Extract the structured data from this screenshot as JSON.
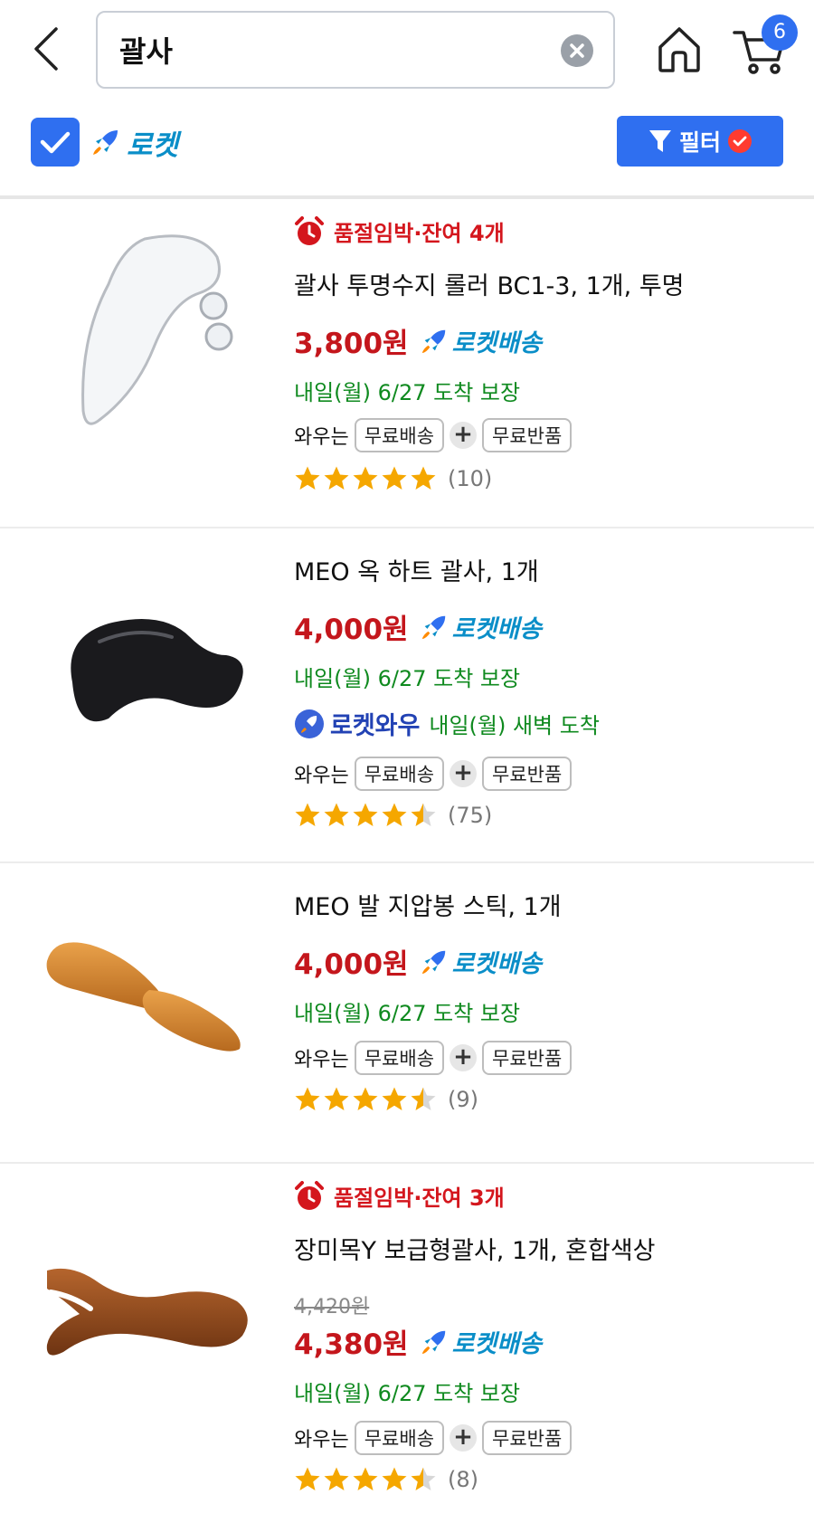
{
  "header": {
    "search": {
      "value": "괄사",
      "placeholder": ""
    },
    "cart_count": "6",
    "rocket_filter": {
      "label": "로켓",
      "checked": true
    },
    "filter_button": {
      "label": "필터"
    }
  },
  "colors": {
    "accent_blue": "#2f6ff0",
    "price_red": "#c4161c",
    "delivery_green": "#0f8a1f",
    "rocket_cyan": "#0a8ec8",
    "star_gold": "#f5a700"
  },
  "icons": [
    "back-arrow-icon",
    "clear-icon",
    "home-icon",
    "cart-icon",
    "checkmark-icon",
    "rocket-icon",
    "filter-funnel-icon",
    "alarm-clock-icon",
    "star-icon"
  ],
  "products": [
    {
      "urgent": "품절임박·잔여 4개",
      "title": "괄사 투명수지 롤러 BC1-3, 1개, 투명",
      "price": "3,800원",
      "rocket": "로켓배송",
      "delivery": "내일(월) 6/27 도착 보장",
      "benefits": {
        "label": "와우는",
        "chip1": "무료배송",
        "chip2": "무료반품"
      },
      "rating": 5,
      "review_count": "(10)"
    },
    {
      "title": "MEO 옥 하트 괄사, 1개",
      "price": "4,000원",
      "rocket": "로켓배송",
      "delivery": "내일(월) 6/27 도착 보장",
      "wow": {
        "label": "로켓와우",
        "text": "내일(월) 새벽 도착"
      },
      "benefits": {
        "label": "와우는",
        "chip1": "무료배송",
        "chip2": "무료반품"
      },
      "rating": 4.5,
      "review_count": "(75)"
    },
    {
      "title": "MEO 발 지압봉 스틱, 1개",
      "price": "4,000원",
      "rocket": "로켓배송",
      "delivery": "내일(월) 6/27 도착 보장",
      "benefits": {
        "label": "와우는",
        "chip1": "무료배송",
        "chip2": "무료반품"
      },
      "rating": 4.5,
      "review_count": "(9)"
    },
    {
      "urgent": "품절임박·잔여 3개",
      "title": "장미목Y 보급형괄사, 1개, 혼합색상",
      "original_price": "4,420원",
      "price": "4,380원",
      "rocket": "로켓배송",
      "delivery": "내일(월) 6/27 도착 보장",
      "benefits": {
        "label": "와우는",
        "chip1": "무료배송",
        "chip2": "무료반품"
      },
      "rating": 4.5,
      "review_count": "(8)"
    }
  ]
}
